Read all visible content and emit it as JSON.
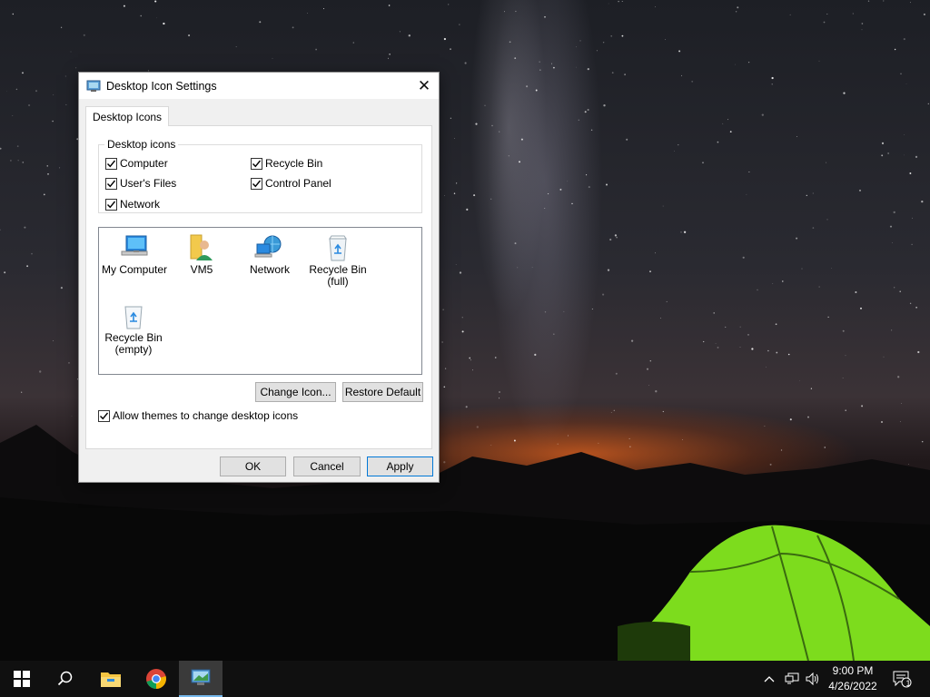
{
  "dialog": {
    "title": "Desktop Icon Settings",
    "tab_label": "Desktop Icons",
    "group_label": "Desktop icons",
    "checkboxes": [
      {
        "label": "Computer",
        "checked": true
      },
      {
        "label": "Recycle Bin",
        "checked": true
      },
      {
        "label": "User's Files",
        "checked": true
      },
      {
        "label": "Control Panel",
        "checked": true
      },
      {
        "label": "Network",
        "checked": true
      }
    ],
    "icons": [
      {
        "label": "My Computer",
        "icon": "computer-icon"
      },
      {
        "label": "VM5",
        "icon": "user-folder-icon"
      },
      {
        "label": "Network",
        "icon": "network-icon"
      },
      {
        "label": "Recycle Bin (full)",
        "icon": "recycle-bin-full-icon"
      },
      {
        "label": "Recycle Bin (empty)",
        "icon": "recycle-bin-empty-icon"
      }
    ],
    "change_icon_label": "Change Icon...",
    "restore_default_label": "Restore Default",
    "allow_themes_label": "Allow themes to change desktop icons",
    "allow_themes_checked": true,
    "ok_label": "OK",
    "cancel_label": "Cancel",
    "apply_label": "Apply"
  },
  "taskbar": {
    "items": [
      "start-icon",
      "search-icon",
      "file-explorer-icon",
      "chrome-icon",
      "desktop-settings-icon"
    ],
    "time": "9:00 PM",
    "date": "4/26/2022",
    "notification_count": "1"
  },
  "colors": {
    "accent": "#0078d7",
    "taskbar": "#101010",
    "dialog_bg": "#f0f0f0"
  }
}
